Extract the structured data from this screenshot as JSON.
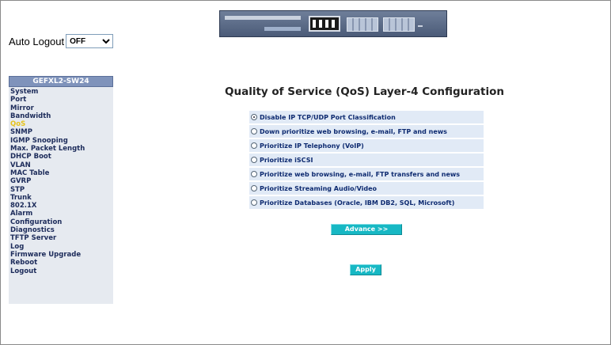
{
  "auto_logout": {
    "label": "Auto Logout",
    "selected": "OFF"
  },
  "sidebar": {
    "title": "GEFXL2-SW24",
    "items": [
      {
        "label": "System",
        "active": false
      },
      {
        "label": "Port",
        "active": false
      },
      {
        "label": "Mirror",
        "active": false
      },
      {
        "label": "Bandwidth",
        "active": false
      },
      {
        "label": "QoS",
        "active": true
      },
      {
        "label": "SNMP",
        "active": false
      },
      {
        "label": "IGMP Snooping",
        "active": false
      },
      {
        "label": "Max. Packet Length",
        "active": false
      },
      {
        "label": "DHCP Boot",
        "active": false
      },
      {
        "label": "VLAN",
        "active": false
      },
      {
        "label": "MAC Table",
        "active": false
      },
      {
        "label": "GVRP",
        "active": false
      },
      {
        "label": "STP",
        "active": false
      },
      {
        "label": "Trunk",
        "active": false
      },
      {
        "label": "802.1X",
        "active": false
      },
      {
        "label": "Alarm",
        "active": false
      },
      {
        "label": "Configuration",
        "active": false
      },
      {
        "label": "Diagnostics",
        "active": false
      },
      {
        "label": "TFTP Server",
        "active": false
      },
      {
        "label": "Log",
        "active": false
      },
      {
        "label": "Firmware Upgrade",
        "active": false
      },
      {
        "label": "Reboot",
        "active": false
      },
      {
        "label": "Logout",
        "active": false
      }
    ]
  },
  "main": {
    "title": "Quality of Service (QoS) Layer-4 Configuration",
    "options": [
      {
        "label": "Disable IP TCP/UDP Port Classification",
        "checked": true
      },
      {
        "label": "Down prioritize web browsing, e-mail, FTP and news",
        "checked": false
      },
      {
        "label": "Prioritize IP Telephony (VoIP)",
        "checked": false
      },
      {
        "label": "Prioritize iSCSI",
        "checked": false
      },
      {
        "label": "Prioritize web browsing, e-mail, FTP transfers and news",
        "checked": false
      },
      {
        "label": "Prioritize Streaming Audio/Video",
        "checked": false
      },
      {
        "label": "Prioritize Databases (Oracle, IBM DB2, SQL, Microsoft)",
        "checked": false
      }
    ],
    "advance_label": "Advance >>",
    "apply_label": "Apply"
  },
  "colors": {
    "sidebar_bg": "#e6eaf0",
    "sidebar_title_bg": "#7f93bb",
    "active_item": "#e6c21b",
    "option_bg": "#e1eaf6",
    "button_bg": "#17b8c4"
  },
  "icons": {
    "header": "switch-device-icon",
    "dropdown": "chevron-down-icon"
  }
}
